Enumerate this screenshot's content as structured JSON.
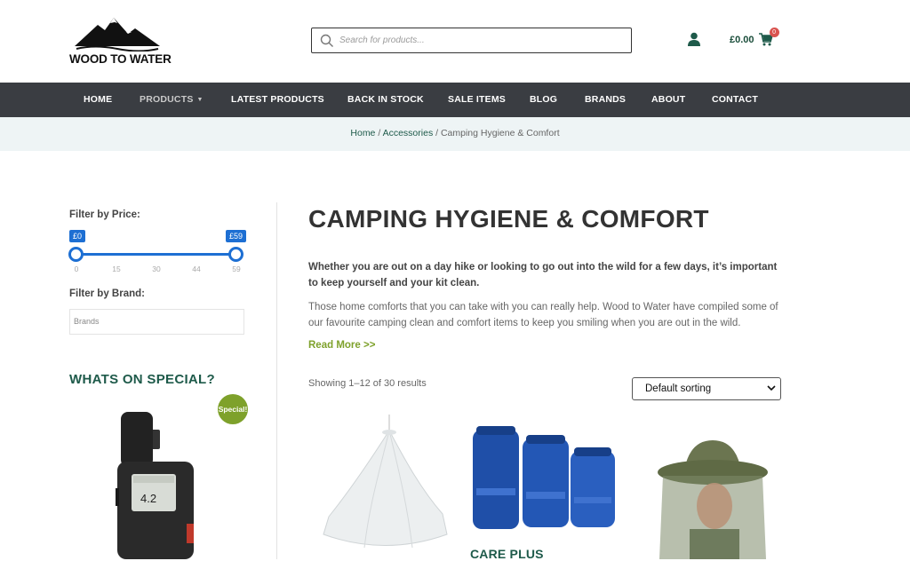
{
  "header": {
    "logo_text": "WOOD TO WATER",
    "search_placeholder": "Search for products...",
    "cart_total": "£0.00",
    "cart_count": "0"
  },
  "nav": {
    "items": [
      {
        "label": "HOME"
      },
      {
        "label": "PRODUCTS"
      },
      {
        "label": "LATEST PRODUCTS"
      },
      {
        "label": "BACK IN STOCK"
      },
      {
        "label": "SALE ITEMS"
      },
      {
        "label": "BLOG"
      },
      {
        "label": "BRANDS"
      },
      {
        "label": "ABOUT"
      },
      {
        "label": "CONTACT"
      }
    ]
  },
  "breadcrumb": {
    "home": "Home",
    "sep1": " / ",
    "accessories": "Accessories",
    "sep2": " / ",
    "current": "Camping Hygiene & Comfort"
  },
  "sidebar": {
    "price_heading": "Filter by Price:",
    "price_min": "£0",
    "price_max": "£59",
    "ticks": [
      "0",
      "15",
      "30",
      "44",
      "59"
    ],
    "brand_heading": "Filter by Brand:",
    "brand_placeholder": "Brands",
    "special_heading": "WHATS ON SPECIAL?",
    "special_badge": "Special!"
  },
  "main": {
    "title": "CAMPING HYGIENE & COMFORT",
    "lead": "Whether you are out on a day hike or looking to go out into the wild for a few days, it’s important to keep yourself and your kit clean.",
    "para": "Those home comforts that you can take with you can really help. Wood to Water have compiled some of our favourite camping clean and comfort items to keep you smiling when you are out in the wild.",
    "read_more": "Read More >>",
    "results": "Showing 1–12 of 30 results",
    "sort_selected": "Default sorting",
    "product_brand_2": "CARE PLUS"
  },
  "colors": {
    "nav_bg": "#3a3d42",
    "brand_green": "#1e5a4a",
    "accent_green": "#7ea12b",
    "slider_blue": "#1d6fd3"
  }
}
